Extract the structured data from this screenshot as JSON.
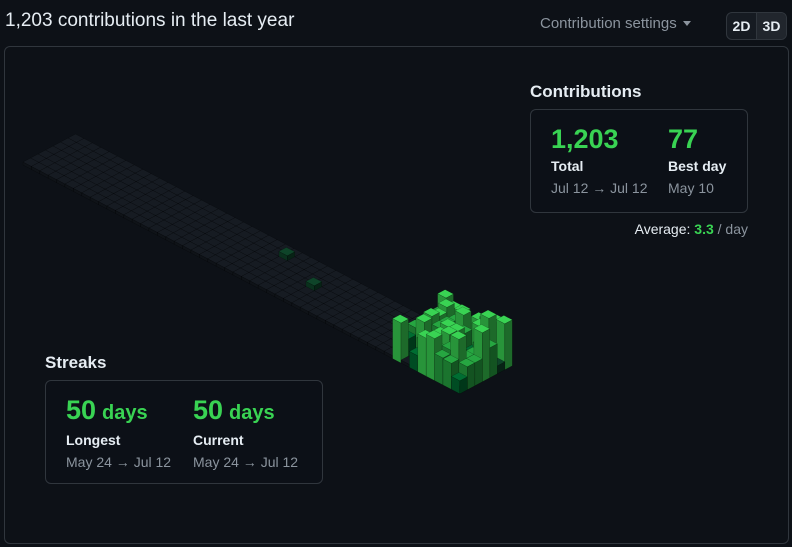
{
  "header": {
    "title": "1,203 contributions in the last year",
    "settings_label": "Contribution settings",
    "view_2d": "2D",
    "view_3d": "3D",
    "active_view": "3D"
  },
  "contributions": {
    "heading": "Contributions",
    "total_value": "1,203",
    "total_label": "Total",
    "total_range": "Jul 12 → Jul 12",
    "best_value": "77",
    "best_label": "Best day",
    "best_date": "May 10",
    "average_label": "Average:",
    "average_value": "3.3",
    "average_unit": "/ day"
  },
  "streaks": {
    "heading": "Streaks",
    "longest_value": "50",
    "longest_unit": "days",
    "longest_label": "Longest",
    "longest_range": "May 24 → Jul 12",
    "current_value": "50",
    "current_unit": "days",
    "current_label": "Current",
    "current_range": "May 24 → Jul 12"
  },
  "colors": {
    "background": "#0d1117",
    "border": "#30363d",
    "accent_green": "#39d353",
    "muted_text": "#8b949e",
    "empty_cell": "#161b22"
  }
}
